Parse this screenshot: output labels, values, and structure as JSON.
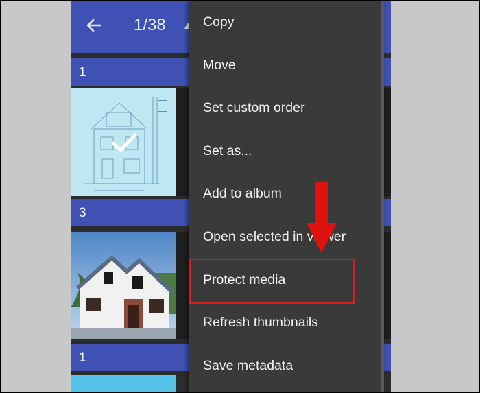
{
  "viewer": {
    "counter": "1/38",
    "back_icon": "arrow-left-icon"
  },
  "sections": [
    {
      "count": "1"
    },
    {
      "count": "3"
    },
    {
      "count": "1"
    }
  ],
  "thumbnails": [
    {
      "description_icon": "house-blueprint-image",
      "selected": true
    },
    {
      "description_icon": "house-photo-image",
      "selected": false
    },
    {
      "description_icon": "sky-image",
      "selected": false
    }
  ],
  "menu": {
    "items": [
      {
        "label": "Copy"
      },
      {
        "label": "Move"
      },
      {
        "label": "Set custom order"
      },
      {
        "label": "Set as..."
      },
      {
        "label": "Add to album"
      },
      {
        "label": "Open selected in viewer"
      },
      {
        "label": "Protect media"
      },
      {
        "label": "Refresh thumbnails"
      },
      {
        "label": "Save metadata"
      }
    ],
    "highlighted_item": "Protect media"
  },
  "colors": {
    "accent": "#3f51b5",
    "menu_background": "#3a3a3a",
    "annotation": "#d51f1f"
  }
}
